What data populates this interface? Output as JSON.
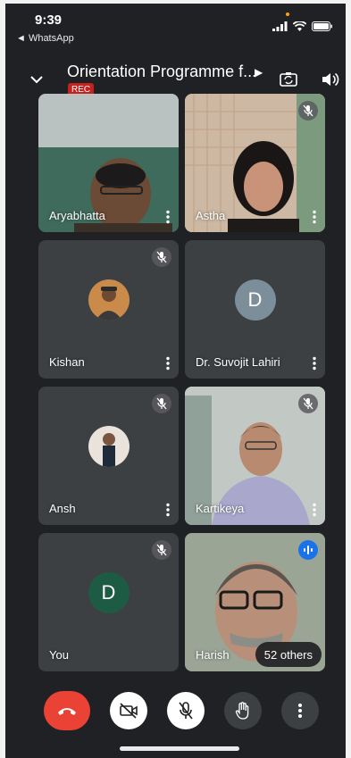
{
  "status_bar": {
    "time": "9:39",
    "back_app": "◄ WhatsApp"
  },
  "header": {
    "meeting_title": "Orientation Programme f...",
    "rec_label": "REC"
  },
  "tiles": [
    {
      "name": "Aryabhatta",
      "muted": false,
      "kind": "video"
    },
    {
      "name": "Astha",
      "muted": true,
      "kind": "video"
    },
    {
      "name": "Kishan",
      "muted": true,
      "kind": "photo"
    },
    {
      "name": "Dr. Suvojit Lahiri",
      "muted": false,
      "kind": "letter",
      "letter": "D",
      "color": "#7b8e9a"
    },
    {
      "name": "Ansh",
      "muted": true,
      "kind": "photo"
    },
    {
      "name": "Kartikeya",
      "muted": true,
      "kind": "video"
    },
    {
      "name": "You",
      "muted": true,
      "kind": "letter",
      "letter": "D",
      "color": "#1e5b44"
    },
    {
      "name": "Harish",
      "muted": false,
      "speaking": true,
      "kind": "video",
      "others_label": "52 others"
    }
  ],
  "controls": {
    "end_call": "end-call",
    "camera": "camera-off",
    "mic": "mic-off",
    "hand": "raise-hand",
    "more": "more"
  },
  "colors": {
    "background": "#202124",
    "tile": "#3c4043",
    "end_call": "#ea4335",
    "rec": "#c5221f",
    "speaking": "#1a73e8"
  }
}
